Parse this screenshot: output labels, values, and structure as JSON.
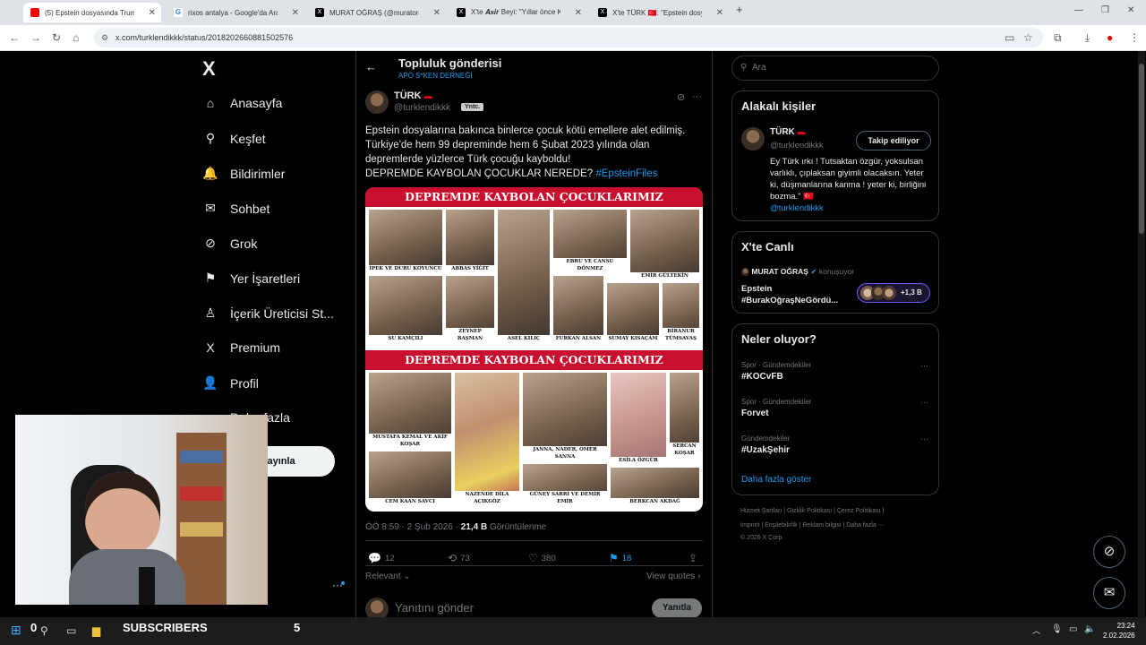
{
  "browser": {
    "tabs": [
      {
        "label": "(5) Epstein dosyasında Trump ile",
        "fav_color": "#ff0000",
        "fav_text": ""
      },
      {
        "label": "rixos antalya - Google'da Ara",
        "fav_color": "#ffffff",
        "fav_text": "G"
      },
      {
        "label": "MURAT OĞRAŞ (@muratoras) / X",
        "fav_color": "#000000",
        "fav_text": "X"
      },
      {
        "label": "X'te 𝑨𝒔𝒊𝒓 Beyi: \"Yıllar önce Ku",
        "fav_color": "#000000",
        "fav_text": "X"
      },
      {
        "label": "X'te TÜRK 🇹🇷: \"Epstein dosyaları",
        "fav_color": "#000000",
        "fav_text": "X"
      }
    ],
    "url": "x.com/turklendikkk/status/2018202660881502576"
  },
  "sidebar": {
    "logo": "X",
    "items": [
      {
        "label": "Anasayfa",
        "icon": "⌂"
      },
      {
        "label": "Keşfet",
        "icon": "⚲"
      },
      {
        "label": "Bildirimler",
        "icon": "🔔"
      },
      {
        "label": "Sohbet",
        "icon": "✉"
      },
      {
        "label": "Grok",
        "icon": "⊘"
      },
      {
        "label": "Yer İşaretleri",
        "icon": "⚑"
      },
      {
        "label": "İçerik Üreticisi St...",
        "icon": "♙"
      },
      {
        "label": "Premium",
        "icon": "X"
      },
      {
        "label": "Profil",
        "icon": "👤"
      },
      {
        "label": "Daha fazla",
        "icon": "⋯"
      }
    ],
    "post_button": "yayınla"
  },
  "header": {
    "title": "Topluluk gönderisi",
    "subtitle": "APO S*KEN DERNEĞİ"
  },
  "tweet": {
    "name": "TÜRK",
    "flag": "🇹🇷",
    "handle": "@turklendikkk",
    "badge": "Yntc.",
    "text_line1": "Epstein dosyalarına bakınca binlerce çocuk kötü emellere alet edilmiş.",
    "text_line2": "Türkiye'de hem 99 depreminde hem 6 Şubat 2023 yılında olan",
    "text_line3": "depremlerde yüzlerce Türk çocuğu kayboldu!",
    "text_line4": "DEPREMDE KAYBOLAN ÇOCUKLAR NEREDE?",
    "hashtag": "#EpsteinFiles",
    "image_banner": "DEPREMDE KAYBOLAN ÇOCUKLARIMIZ",
    "captions_top": [
      "İPEK VE DURU KOYUNCU",
      "ABBAS YİĞİT",
      "ASEL KILIÇ",
      "EBRU VE CANSU DÖNMEZ",
      "EMİR GÜLTEKİN",
      "SU KAMÇILI",
      "ZEYNEP BAŞMAN",
      "FURKAN ALSAN",
      "SUMAY KISAÇAM",
      "BİRANUR TÜMSAVAŞ"
    ],
    "captions_bottom": [
      "MUSTAFA KEMAL VE AKİF KOŞAR",
      "JANNA, NADER, OMER SANNA",
      "ESİLA ÖZGÜR",
      "SERCAN KOŞAR",
      "CEM KAAN SAVCI",
      "NAZENDE DİLA AÇIKGÖZ",
      "BERKCAN AKDAĞ",
      "GÜNEY SARRİ VE DEMİR EMİR"
    ],
    "time": "ÖÖ 8:59 · 2 Şub 2026 ·",
    "views": "21,4 B",
    "views_label": "Görüntülenme",
    "replies": "12",
    "reposts": "73",
    "likes": "380",
    "bookmarks": "18",
    "sort": "Relevant",
    "view_quotes": "View quotes",
    "reply_placeholder": "Yanıtını gönder",
    "reply_button": "Yanıtla"
  },
  "right": {
    "search_placeholder": "Ara",
    "related_title": "Alakalı kişiler",
    "related_name": "TÜRK",
    "related_handle": "@turklendikkk",
    "follow_label": "Takip ediliyor",
    "bio": "Ey Türk ırkı ! Tutsaktan özgür, yoksulsan varlıklı, çıplaksan giyimli olacaksın. Yeter ki, düşmanlarına kanma ! yeter ki, birliğini bozma.\" 🇹🇷",
    "bio_link": "@turklendikkk",
    "live_title": "X'te Canlı",
    "live_host": "MURAT OĞRAŞ",
    "live_status": "konuşuyor",
    "live_topic1": "Epstein",
    "live_topic2": "#BurakOğraşNeGördü...",
    "live_count": "+1,3 B",
    "trends_title": "Neler oluyor?",
    "trends": [
      {
        "cat": "Spor · Gündemdekiler",
        "name": "#KOCvFB"
      },
      {
        "cat": "Spor · Gündemdekiler",
        "name": "Forvet"
      },
      {
        "cat": "Gündemdekiler",
        "name": "#UzakŞehir"
      }
    ],
    "show_more": "Daha fazla göster",
    "footer1": "Hizmet Şartları  |  Gizlilik Politikası  |  Çerez Politikası  |",
    "footer2": "Imprint  |  Erişilebilirlik  |  Reklam bilgisi  |  Daha fazla ···",
    "footer3": "© 2026 X Corp."
  },
  "taskbar": {
    "zero": "0",
    "subscribers": "SUBSCRIBERS",
    "sub_count": "5",
    "time": "23:24",
    "date": "2.02.2026"
  }
}
